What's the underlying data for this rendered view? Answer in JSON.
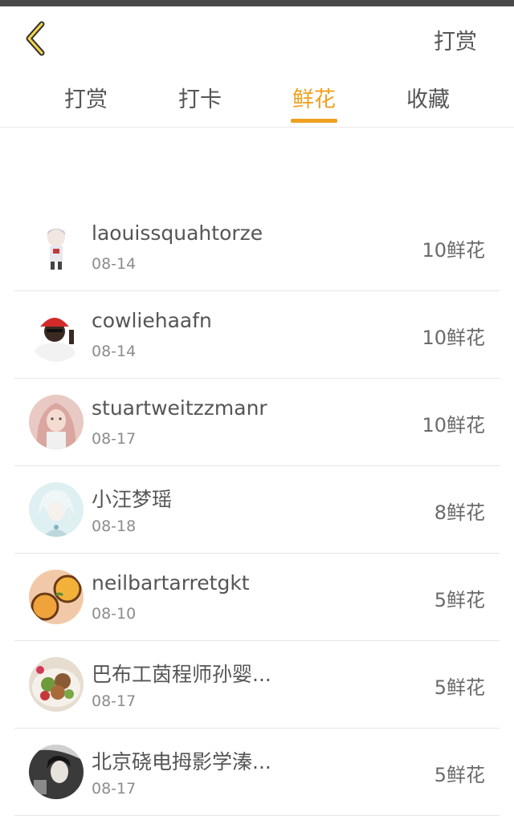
{
  "header": {
    "back_icon": "chevron-left-icon",
    "action_label": "打赏",
    "accent_color": "#f0a020"
  },
  "tabs": [
    {
      "label": "打赏",
      "active": false
    },
    {
      "label": "打卡",
      "active": false
    },
    {
      "label": "鲜花",
      "active": true
    },
    {
      "label": "收藏",
      "active": false
    }
  ],
  "list": [
    {
      "name": "laouissquahtorze",
      "date": "08-14",
      "amount": "10鲜花",
      "avatar": "anime-figure-avatar"
    },
    {
      "name": "cowliehaafn",
      "date": "08-14",
      "amount": "10鲜花",
      "avatar": "red-cap-man-avatar"
    },
    {
      "name": "stuartweitzzmanr",
      "date": "08-17",
      "amount": "10鲜花",
      "avatar": "pink-hair-girl-avatar"
    },
    {
      "name": "小汪梦瑶",
      "date": "08-18",
      "amount": "8鲜花",
      "avatar": "pale-anime-avatar"
    },
    {
      "name": "neilbartarretgkt",
      "date": "08-10",
      "amount": "5鲜花",
      "avatar": "orange-food-avatar"
    },
    {
      "name": "巴布工茵程师孙婴...",
      "date": "08-17",
      "amount": "5鲜花",
      "avatar": "salad-food-avatar"
    },
    {
      "name": "北京硗电拇影学溱...",
      "date": "08-17",
      "amount": "5鲜花",
      "avatar": "dark-portrait-avatar"
    }
  ]
}
